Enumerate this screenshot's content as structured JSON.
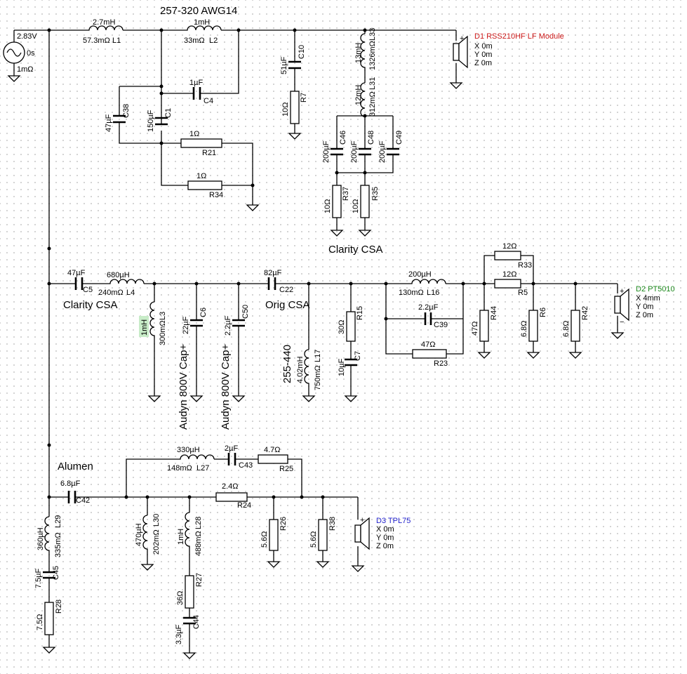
{
  "title": "257-320 AWG14",
  "source": {
    "voltage": "2.83V",
    "phase": "0s",
    "resistance": "1mΩ"
  },
  "notes": {
    "clarity_csa_lf": "Clarity CSA",
    "clarity_csa_mid": "Clarity CSA",
    "orig_csa": "Orig CSA",
    "range_255_440": "255-440",
    "audyn_c6": "Audyn 800V Cap+",
    "audyn_c50": "Audyn 800V Cap+",
    "alumen": "Alumen"
  },
  "drivers": {
    "d1": {
      "name": "D1 RSS210HF LF Module",
      "x": "X 0m",
      "y": "Y 0m",
      "z": "Z 0m",
      "color": "#cc1b1b"
    },
    "d2": {
      "name": "D2 PT5010",
      "x": "X 4mm",
      "y": "Y 0m",
      "z": "Z 0m",
      "color": "#1e8a1e"
    },
    "d3": {
      "name": "D3 TPL75",
      "x": "X 0m",
      "y": "Y 0m",
      "z": "Z 0m",
      "color": "#2222cc"
    }
  },
  "components": {
    "L1": {
      "ref": "L1",
      "value": "2.7mH",
      "dcr": "57.3mΩ"
    },
    "L2": {
      "ref": "L2",
      "value": "1mH",
      "dcr": "33mΩ"
    },
    "C4": {
      "ref": "C4",
      "value": "1µF"
    },
    "C38": {
      "ref": "C38",
      "value": "47µF"
    },
    "C1": {
      "ref": "C1",
      "value": "150µF"
    },
    "R21": {
      "ref": "R21",
      "value": "1Ω"
    },
    "R34": {
      "ref": "R34",
      "value": "1Ω"
    },
    "C10": {
      "ref": "C10",
      "value": "51µF"
    },
    "R7": {
      "ref": "R7",
      "value": "10Ω"
    },
    "L33": {
      "ref": "L33",
      "value": "13mH",
      "dcr": "1326mΩ"
    },
    "L31": {
      "ref": "L31",
      "value": "12mH",
      "dcr": "312mΩ"
    },
    "C46": {
      "ref": "C46",
      "value": "200µF"
    },
    "C48": {
      "ref": "C48",
      "value": "200µF"
    },
    "C49": {
      "ref": "C49",
      "value": "200µF"
    },
    "R37": {
      "ref": "R37",
      "value": "10Ω"
    },
    "R35": {
      "ref": "R35",
      "value": "10Ω"
    },
    "C5": {
      "ref": "C5",
      "value": "47µF"
    },
    "L4": {
      "ref": "L4",
      "value": "680µH",
      "dcr": "240mΩ"
    },
    "L3": {
      "ref": "L3",
      "value": "1mH",
      "dcr": "300mΩ"
    },
    "C6": {
      "ref": "C6",
      "value": "22µF"
    },
    "C50": {
      "ref": "C50",
      "value": "2.2µF"
    },
    "C22": {
      "ref": "C22",
      "value": "82µF"
    },
    "L17": {
      "ref": "L17",
      "value": "4.02mH",
      "dcr": "750mΩ"
    },
    "R15": {
      "ref": "R15",
      "value": "30Ω"
    },
    "C7": {
      "ref": "C7",
      "value": "10µF"
    },
    "L16": {
      "ref": "L16",
      "value": "200µH",
      "dcr": "130mΩ"
    },
    "C39": {
      "ref": "C39",
      "value": "2.2µF"
    },
    "R23": {
      "ref": "R23",
      "value": "47Ω"
    },
    "R44": {
      "ref": "R44",
      "value": "47Ω"
    },
    "R33": {
      "ref": "R33",
      "value": "12Ω"
    },
    "R5": {
      "ref": "R5",
      "value": "12Ω"
    },
    "R6": {
      "ref": "R6",
      "value": "6.8Ω"
    },
    "R42": {
      "ref": "R42",
      "value": "6.8Ω"
    },
    "L27": {
      "ref": "L27",
      "value": "330µH",
      "dcr": "148mΩ"
    },
    "C43": {
      "ref": "C43",
      "value": "2µF"
    },
    "R25": {
      "ref": "R25",
      "value": "4.7Ω"
    },
    "C42": {
      "ref": "C42",
      "value": "6.8µF"
    },
    "R24": {
      "ref": "R24",
      "value": "2.4Ω"
    },
    "L30": {
      "ref": "L30",
      "value": "470µH",
      "dcr": "202mΩ"
    },
    "L28": {
      "ref": "L28",
      "value": "1mH",
      "dcr": "488mΩ"
    },
    "R27": {
      "ref": "R27",
      "value": "36Ω"
    },
    "C44": {
      "ref": "C44",
      "value": "3.3µF"
    },
    "R26": {
      "ref": "R26",
      "value": "5.6Ω"
    },
    "R38": {
      "ref": "R38",
      "value": "5.6Ω"
    },
    "L29": {
      "ref": "L29",
      "value": "360µH",
      "dcr": "335mΩ"
    },
    "C45": {
      "ref": "C45",
      "value": "7.5µF"
    },
    "R28": {
      "ref": "R28",
      "value": "7.5Ω"
    }
  }
}
